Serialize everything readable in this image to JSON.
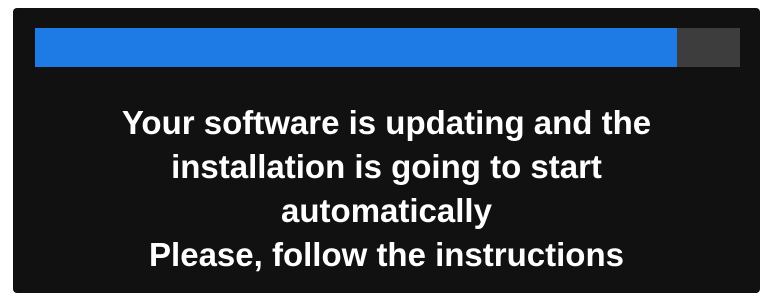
{
  "dialog": {
    "progress": {
      "value_percent": 91,
      "fill_color": "#1e7be6",
      "track_color": "#3d3d3d"
    },
    "message_lines": [
      "Your software is updating and the",
      "installation is going to start",
      "automatically",
      "Please, follow the instructions"
    ]
  }
}
